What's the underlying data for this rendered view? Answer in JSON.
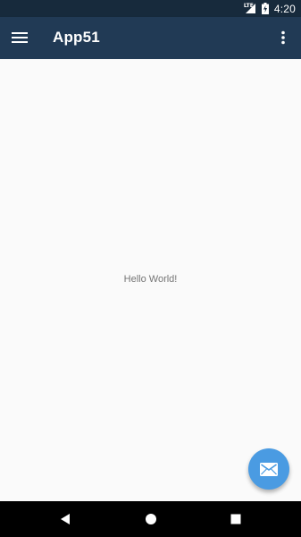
{
  "status_bar": {
    "network_label": "LTE",
    "time": "4:20",
    "icons": [
      "lte-signal-icon",
      "battery-charging-icon"
    ]
  },
  "app_bar": {
    "title": "App51",
    "icons": [
      "hamburger-menu-icon",
      "overflow-menu-icon"
    ]
  },
  "content": {
    "message": "Hello World!"
  },
  "fab": {
    "icon": "email-icon"
  },
  "navigation_bar": {
    "icons": [
      "back-icon",
      "home-icon",
      "recents-icon"
    ]
  },
  "colors": {
    "status_bar": "#172a3c",
    "app_bar": "#213a55",
    "background": "#fafafa",
    "fab": "#4a9be2",
    "text_secondary": "#757575",
    "nav_bar": "#000000"
  }
}
